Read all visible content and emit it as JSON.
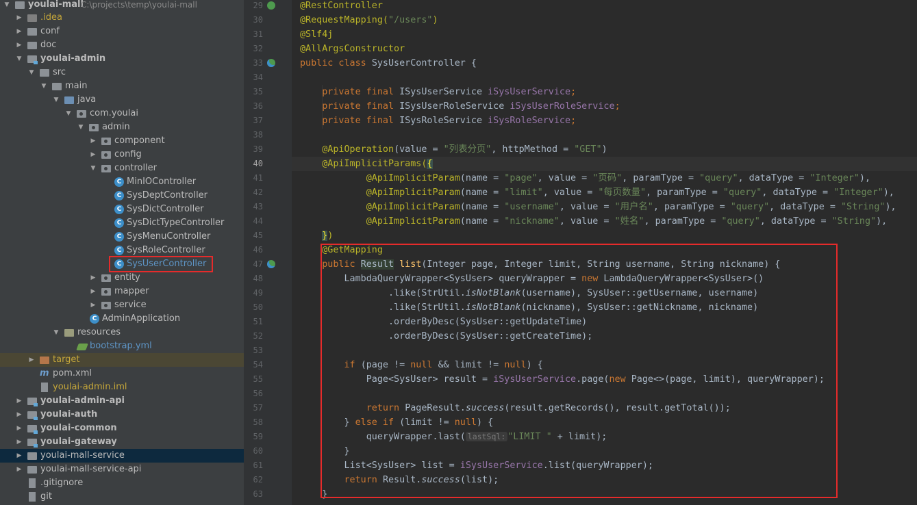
{
  "project_tree": {
    "root": {
      "name": "youlai-mall",
      "path": "C:\\projects\\temp\\youlai-mall"
    },
    "items": [
      {
        "label": "youlai-mall",
        "extra": "C:\\projects\\temp\\youlai-mall"
      },
      {
        "label": ".idea"
      },
      {
        "label": "conf"
      },
      {
        "label": "doc"
      },
      {
        "label": "youlai-admin"
      },
      {
        "label": "src"
      },
      {
        "label": "main"
      },
      {
        "label": "java"
      },
      {
        "label": "com.youlai"
      },
      {
        "label": "admin"
      },
      {
        "label": "component"
      },
      {
        "label": "config"
      },
      {
        "label": "controller"
      },
      {
        "label": "MinIOController"
      },
      {
        "label": "SysDeptController"
      },
      {
        "label": "SysDictController"
      },
      {
        "label": "SysDictTypeController"
      },
      {
        "label": "SysMenuController"
      },
      {
        "label": "SysRoleController"
      },
      {
        "label": "SysUserController"
      },
      {
        "label": "entity"
      },
      {
        "label": "mapper"
      },
      {
        "label": "service"
      },
      {
        "label": "AdminApplication"
      },
      {
        "label": "resources"
      },
      {
        "label": "bootstrap.yml"
      },
      {
        "label": "target"
      },
      {
        "label": "pom.xml"
      },
      {
        "label": "youlai-admin.iml"
      },
      {
        "label": "youlai-admin-api"
      },
      {
        "label": "youlai-auth"
      },
      {
        "label": "youlai-common"
      },
      {
        "label": "youlai-gateway"
      },
      {
        "label": "youlai-mall-service"
      },
      {
        "label": "youlai-mall-service-api"
      },
      {
        "label": ".gitignore"
      },
      {
        "label": "git"
      }
    ],
    "highlighted_item": "SysUserController"
  },
  "editor": {
    "line_numbers": [
      "29",
      "30",
      "31",
      "32",
      "33",
      "34",
      "35",
      "36",
      "37",
      "38",
      "39",
      "40",
      "41",
      "42",
      "43",
      "44",
      "45",
      "46",
      "47",
      "48",
      "49",
      "50",
      "51",
      "52",
      "53",
      "54",
      "55",
      "56",
      "57",
      "58",
      "59",
      "60",
      "61",
      "62",
      "63"
    ],
    "current_line": "40",
    "hint_label": "lastSql:",
    "highlighted_region": "@GetMapping ... list(...) method body",
    "colors": {
      "annotation": "#bbb529",
      "keyword": "#cc7832",
      "string": "#6a8759",
      "field": "#9876aa",
      "method": "#ffc66d",
      "text": "#a9b7c6",
      "highlight_box": "#e52b2b"
    }
  },
  "code": {
    "l29": "@RestController",
    "l30a": "@RequestMapping(",
    "l30b": "\"/users\"",
    "l30c": ")",
    "l31": "@Slf4j",
    "l32": "@AllArgsConstructor",
    "l33a": "public class ",
    "l33b": "SysUserController {",
    "l35a": "    private final ",
    "l35b": "ISysUserService ",
    "l35c": "iSysUserService",
    "l35d": ";",
    "l36a": "    private final ",
    "l36b": "ISysUserRoleService ",
    "l36c": "iSysUserRoleService",
    "l36d": ";",
    "l37a": "    private final ",
    "l37b": "ISysRoleService ",
    "l37c": "iSysRoleService",
    "l37d": ";",
    "l39a": "    @ApiOperation",
    "l39b": "(value = ",
    "l39c": "\"列表分页\"",
    "l39d": ", httpMethod = ",
    "l39e": "\"GET\"",
    "l39f": ")",
    "l40a": "    @ApiImplicitParams",
    "l40b": "(",
    "l40c": "{",
    "l41a": "            @ApiImplicitParam",
    "l41b": "(name = ",
    "l41c": "\"page\"",
    "l41d": ", value = ",
    "l41e": "\"页码\"",
    "l41f": ", paramType = ",
    "l41g": "\"query\"",
    "l41h": ", dataType = ",
    "l41i": "\"Integer\"",
    "l41j": "),",
    "l42a": "            @ApiImplicitParam",
    "l42b": "(name = ",
    "l42c": "\"limit\"",
    "l42d": ", value = ",
    "l42e": "\"每页数量\"",
    "l42f": ", paramType = ",
    "l42g": "\"query\"",
    "l42h": ", dataType = ",
    "l42i": "\"Integer\"",
    "l42j": "),",
    "l43a": "            @ApiImplicitParam",
    "l43b": "(name = ",
    "l43c": "\"username\"",
    "l43d": ", value = ",
    "l43e": "\"用户名\"",
    "l43f": ", paramType = ",
    "l43g": "\"query\"",
    "l43h": ", dataType = ",
    "l43i": "\"String\"",
    "l43j": "),",
    "l44a": "            @ApiImplicitParam",
    "l44b": "(name = ",
    "l44c": "\"nickname\"",
    "l44d": ", value = ",
    "l44e": "\"姓名\"",
    "l44f": ", paramType = ",
    "l44g": "\"query\"",
    "l44h": ", dataType = ",
    "l44i": "\"String\"",
    "l44j": "),",
    "l45a": "    ",
    "l45b": "}",
    "l45c": ")",
    "l46": "    @GetMapping",
    "l47a": "    public ",
    "l47b": "Result",
    "l47c": " ",
    "l47d": "list",
    "l47e": "(Integer page, Integer limit, String username, String nickname) {",
    "l48a": "        LambdaQueryWrapper<SysUser> queryWrapper = ",
    "l48b": "new ",
    "l48c": "LambdaQueryWrapper<SysUser>()",
    "l49a": "                .like(StrUtil.",
    "l49b": "isNotBlank",
    "l49c": "(username), SysUser::getUsername, username)",
    "l50a": "                .like(StrUtil.",
    "l50b": "isNotBlank",
    "l50c": "(nickname), SysUser::getNickname, nickname)",
    "l51": "                .orderByDesc(SysUser::getUpdateTime)",
    "l52": "                .orderByDesc(SysUser::getCreateTime);",
    "l54a": "        if ",
    "l54b": "(page != ",
    "l54c": "null ",
    "l54d": "&& limit != ",
    "l54e": "null",
    "l54f": ") {",
    "l55a": "            Page<SysUser> result = ",
    "l55b": "iSysUserService",
    "l55c": ".page(",
    "l55d": "new ",
    "l55e": "Page<>(page, limit), queryWrapper);",
    "l57a": "            return ",
    "l57b": "PageResult.",
    "l57c": "success",
    "l57d": "(result.getRecords(), result.getTotal());",
    "l58a": "        } ",
    "l58b": "else if ",
    "l58c": "(limit != ",
    "l58d": "null",
    "l58e": ") {",
    "l59a": "            queryWrapper.last(",
    "l59c": "\"LIMIT \"",
    "l59d": " + limit);",
    "l60": "        }",
    "l61a": "        List<SysUser> list = ",
    "l61b": "iSysUserService",
    "l61c": ".list(queryWrapper);",
    "l62a": "        return ",
    "l62b": "Result.",
    "l62c": "success",
    "l62d": "(list);",
    "l63": "    }"
  }
}
